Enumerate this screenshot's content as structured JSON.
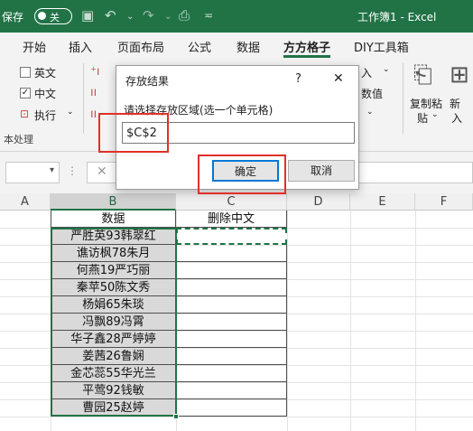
{
  "titlebar": {
    "autosave_label": "保存",
    "autosave_state": "关",
    "window_title": "工作簿1 - Excel"
  },
  "ribbon_tabs": [
    "开始",
    "插入",
    "页面布局",
    "公式",
    "数据",
    "方方格子",
    "DIY工具箱"
  ],
  "active_tab": "方方格子",
  "ribbon": {
    "options": [
      {
        "label": "英文",
        "checked": false
      },
      {
        "label": "中文",
        "checked": true
      }
    ],
    "execute_label": "执行",
    "group_label": "本处理",
    "right_insert_label": "入",
    "right_number_label": "数值",
    "paste_label": "复制粘",
    "paste_label2": "贴",
    "new_label": "新",
    "new_label2": "入"
  },
  "dialog": {
    "title": "存放结果",
    "help": "?",
    "close": "✕",
    "prompt": "请选择存放区域(选一个单元格)",
    "input_value": "$C$2",
    "ok_label": "确定",
    "cancel_label": "取消"
  },
  "columns": [
    "A",
    "B",
    "C",
    "D",
    "E",
    "F"
  ],
  "selected_column": "B",
  "sheet": {
    "b_header": "数据",
    "c_header": "删除中文",
    "b_values": [
      "严胜英93韩翠红",
      "谯访枫78朱月",
      "何燕19严巧丽",
      "秦苹50陈文秀",
      "杨娟65朱琰",
      "冯飘89冯霄",
      "华子鑫28严婷婷",
      "姜茜26鲁娴",
      "金芯蕊55华光兰",
      "平莺92钱敏",
      "曹园25赵婷"
    ]
  },
  "colors": {
    "excel_green": "#217346",
    "highlight_red": "#e0302a",
    "selection_gray": "#d9d9d9"
  }
}
